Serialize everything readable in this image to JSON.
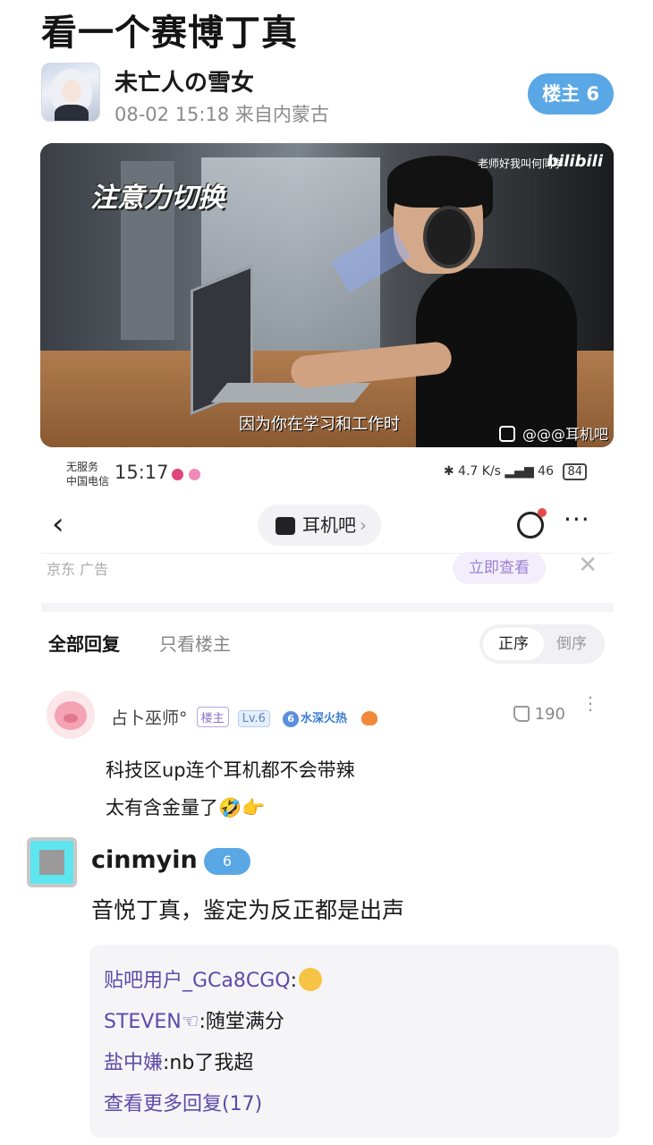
{
  "post": {
    "title": "看一个赛博丁真",
    "author": "未亡人の雪女",
    "meta": "08-02 15:18 来自内蒙古",
    "floor_badge": "楼主 6"
  },
  "video": {
    "caption_title": "注意力切换",
    "top_right_text": "老师好我叫何同学",
    "platform": "bilibili",
    "subtitle": "因为你在学习和工作时",
    "watermark": "@@@耳机吧"
  },
  "status_bar": {
    "carrier_line1": "无服务",
    "carrier_line2": "中国电信",
    "time": "15:17",
    "net_speed": "4.7 K/s",
    "signal": "46",
    "battery": "84"
  },
  "nav": {
    "back": "‹",
    "forum_name": "耳机吧",
    "chevron": "›",
    "more": "···"
  },
  "ad": {
    "label": "京东 广告",
    "button": "立即查看",
    "close": "✕"
  },
  "tabs": {
    "all": "全部回复",
    "op_only": "只看楼主",
    "sort_asc": "正序",
    "sort_desc": "倒序"
  },
  "reply1": {
    "name": "占卜巫师°",
    "tag_op": "楼主",
    "tag_level": "Lv.6",
    "tag_deep_num": "6",
    "tag_deep": "水深火热",
    "likes": "190",
    "more": "⋮",
    "line1": "科技区up连个耳机都不会带辣",
    "line2": "太有含金量了🤣👉"
  },
  "comment": {
    "name": "cinmyin",
    "level": "6",
    "text": "音悦丁真，鉴定为反正都是出声",
    "subreplies": [
      {
        "user": "贴吧用户_GCa8CGQ",
        "text": ":"
      },
      {
        "user": "STEVEN☜",
        "text": ":随堂满分"
      },
      {
        "user": "盐中嫌",
        "text": ":nb了我超"
      }
    ],
    "see_more": "查看更多回复(17)"
  }
}
